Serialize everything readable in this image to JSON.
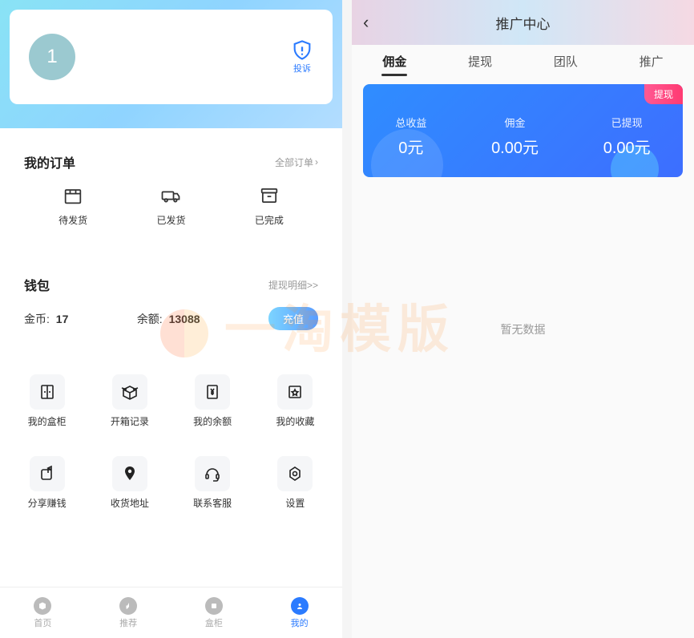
{
  "left": {
    "avatar_label": "1",
    "complaint": {
      "label": "投诉"
    },
    "orders": {
      "title": "我的订单",
      "more": "全部订单",
      "items": [
        {
          "label": "待发货"
        },
        {
          "label": "已发货"
        },
        {
          "label": "已完成"
        }
      ]
    },
    "wallet": {
      "title": "钱包",
      "more": "提现明细>>",
      "coin_label": "金币:",
      "coin_value": "17",
      "balance_label": "余额:",
      "balance_value": "13088",
      "recharge": "充值"
    },
    "grid": [
      {
        "label": "我的盒柜"
      },
      {
        "label": "开箱记录"
      },
      {
        "label": "我的余额"
      },
      {
        "label": "我的收藏"
      },
      {
        "label": "分享赚钱"
      },
      {
        "label": "收货地址"
      },
      {
        "label": "联系客服"
      },
      {
        "label": "设置"
      }
    ],
    "tabs": [
      {
        "label": "首页"
      },
      {
        "label": "推荐"
      },
      {
        "label": "盒柜"
      },
      {
        "label": "我的"
      }
    ]
  },
  "right": {
    "title": "推广中心",
    "tabs": [
      {
        "label": "佣金"
      },
      {
        "label": "提现"
      },
      {
        "label": "团队"
      },
      {
        "label": "推广"
      }
    ],
    "banner": {
      "withdraw_btn": "提现",
      "stats": [
        {
          "label": "总收益",
          "value": "0元"
        },
        {
          "label": "佣金",
          "value": "0.00元"
        },
        {
          "label": "已提现",
          "value": "0.00元"
        }
      ]
    },
    "empty": "暂无数据"
  },
  "watermark": "一淘模版"
}
